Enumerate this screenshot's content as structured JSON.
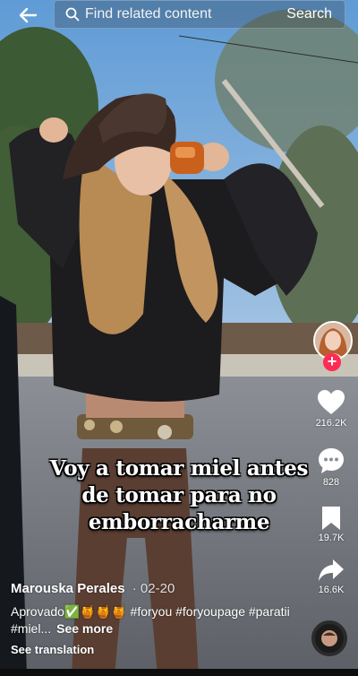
{
  "search": {
    "placeholder": "Find related content",
    "button_label": "Search"
  },
  "caption_overlay": {
    "lines": [
      "Voy a tomar miel antes",
      "de tomar para no",
      "emborracharme"
    ]
  },
  "actions": {
    "likes": "216.2K",
    "comments": "828",
    "saves": "19.7K",
    "shares": "16.6K",
    "follow_symbol": "+"
  },
  "post": {
    "author": "Marouska Perales",
    "date": "02-20",
    "description": "Aprovado✅🍯🍯🍯 #foryou #foryoupage #paratii #miel...",
    "see_more": "See more",
    "see_translation": "See translation"
  },
  "colors": {
    "like": "#ffffff",
    "follow": "#fe2c55",
    "text": "#ffffff"
  },
  "icons": [
    "back-arrow-icon",
    "search-icon",
    "heart-icon",
    "comment-icon",
    "bookmark-icon",
    "share-icon",
    "music-disc-icon"
  ]
}
